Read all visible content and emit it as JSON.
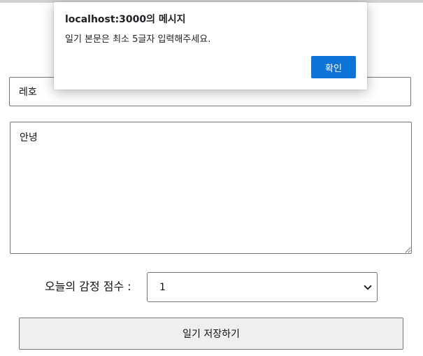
{
  "dialog": {
    "title": "localhost:3000의 메시지",
    "message": "일기 본문은 최소 5글자 입력해주세요.",
    "ok_label": "확인",
    "accent": "#0b74d6"
  },
  "form": {
    "author_value": "레호",
    "content_value": "안녕",
    "emotion_label": "오늘의 감정 점수 :",
    "emotion_selected": "1",
    "save_label": "일기 저장하기"
  },
  "icons": {
    "select_arrow": "chevron-down-icon",
    "resize_handle": "resize-grip-icon"
  }
}
